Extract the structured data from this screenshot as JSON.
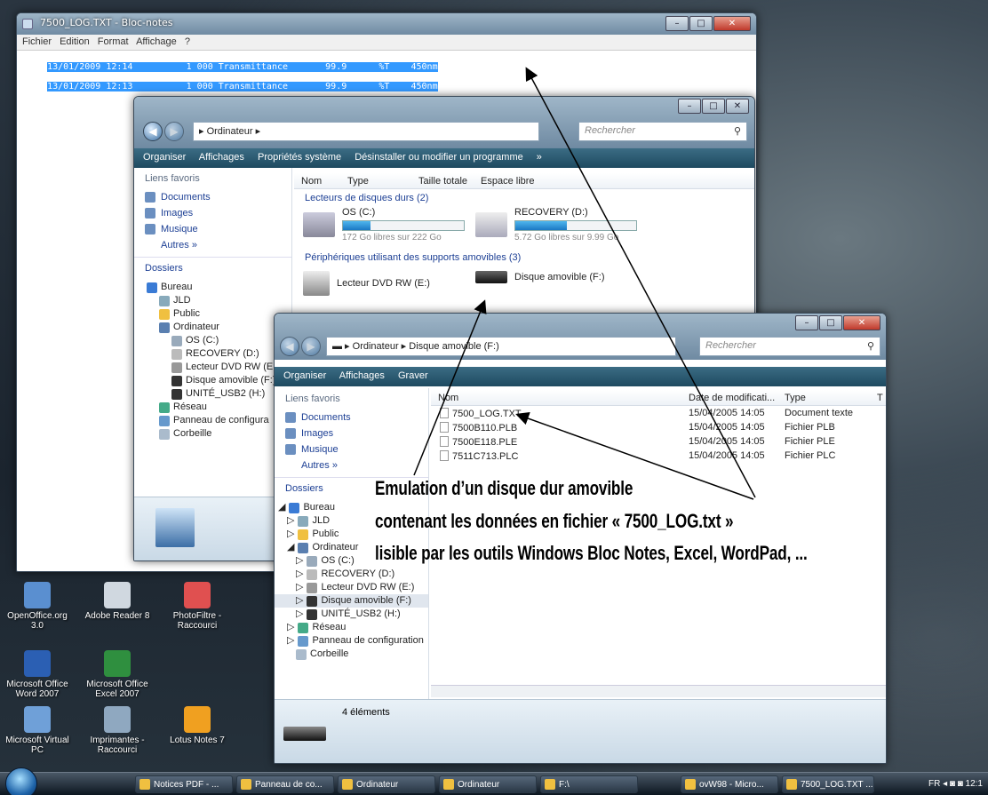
{
  "notepad": {
    "title": "7500_LOG.TXT - Bloc-notes",
    "menu": [
      "Fichier",
      "Edition",
      "Format",
      "Affichage",
      "?"
    ],
    "lines": [
      "13/01/2009 12:14          1 000 Transmittance       99.9      %T    450nm",
      "13/01/2009 12:13          1 000 Transmittance       99.9      %T    450nm"
    ]
  },
  "explorer1": {
    "address": "Ordinateur",
    "search_placeholder": "Rechercher",
    "commands": [
      "Organiser",
      "Affichages",
      "Propriétés système",
      "Désinstaller ou modifier un programme",
      "»"
    ],
    "favorites_header": "Liens favoris",
    "favorites": [
      "Documents",
      "Images",
      "Musique"
    ],
    "more": "Autres »",
    "folders_header": "Dossiers",
    "tree": [
      "Bureau",
      "JLD",
      "Public",
      "Ordinateur",
      "OS (C:)",
      "RECOVERY (D:)",
      "Lecteur DVD RW (E:)",
      "Disque amovible (F:)",
      "UNITÉ_USB2 (H:)",
      "Réseau",
      "Panneau de configura",
      "Corbeille"
    ],
    "columns": [
      "Nom",
      "Type",
      "Taille totale",
      "Espace libre"
    ],
    "group_hdd": "Lecteurs de disques durs (2)",
    "group_removable": "Périphériques utilisant des supports amovibles (3)",
    "drives": [
      {
        "name": "OS (C:)",
        "free": "172 Go libres sur 222 Go",
        "used": 0.23
      },
      {
        "name": "RECOVERY (D:)",
        "free": "5.72 Go libres sur 9.99 Go",
        "used": 0.43
      }
    ],
    "removable": [
      "Lecteur DVD RW (E:)",
      "Disque amovible (F:)"
    ]
  },
  "explorer2": {
    "address_root": "Ordinateur",
    "address_leaf": "Disque amovible (F:)",
    "search_placeholder": "Rechercher",
    "commands": [
      "Organiser",
      "Affichages",
      "Graver"
    ],
    "favorites_header": "Liens favoris",
    "favorites": [
      "Documents",
      "Images",
      "Musique"
    ],
    "more": "Autres »",
    "folders_header": "Dossiers",
    "tree": [
      "Bureau",
      "JLD",
      "Public",
      "Ordinateur",
      "OS (C:)",
      "RECOVERY (D:)",
      "Lecteur DVD RW (E:)",
      "Disque amovible (F:)",
      "UNITÉ_USB2 (H:)",
      "Réseau",
      "Panneau de configuration",
      "Corbeille"
    ],
    "columns": [
      "Nom",
      "Date de modificati...",
      "Type",
      "T"
    ],
    "files": [
      {
        "name": "7500_LOG.TXT",
        "date": "15/04/2005 14:05",
        "type": "Document texte"
      },
      {
        "name": "7500B110.PLB",
        "date": "15/04/2005 14:05",
        "type": "Fichier PLB"
      },
      {
        "name": "7500E118.PLE",
        "date": "15/04/2005 14:05",
        "type": "Fichier PLE"
      },
      {
        "name": "7511C713.PLC",
        "date": "15/04/2005 14:05",
        "type": "Fichier PLC"
      }
    ],
    "status": "4 éléments"
  },
  "annotation": [
    "Emulation d’un disque dur amovible",
    "contenant les données en fichier « 7500_LOG.txt »",
    "lisible par les outils Windows Bloc Notes, Excel, WordPad, ..."
  ],
  "desktop_icons": [
    {
      "label": "OpenOffice.org 3.0",
      "color": "#5a8fd0"
    },
    {
      "label": "Adobe Reader 8",
      "color": "#d0d8e0"
    },
    {
      "label": "PhotoFiltre - Raccourci",
      "color": "#e05050"
    },
    {
      "label": "Microsoft Office Word 2007",
      "color": "#2b5fb3"
    },
    {
      "label": "Microsoft Office Excel 2007",
      "color": "#2f8f3f"
    },
    {
      "label": "Microsoft Virtual PC",
      "color": "#6fa0d8"
    },
    {
      "label": "Imprimantes - Raccourci",
      "color": "#8fa8c0"
    },
    {
      "label": "Lotus Notes 7",
      "color": "#f0a020"
    }
  ],
  "taskbar": {
    "buttons": [
      "Notices PDF - ...",
      "Panneau de co...",
      "Ordinateur",
      "Ordinateur",
      "F:\\",
      "ovW98 - Micro...",
      "7500_LOG.TXT ..."
    ],
    "tray_lang": "FR",
    "clock": "12:1"
  }
}
